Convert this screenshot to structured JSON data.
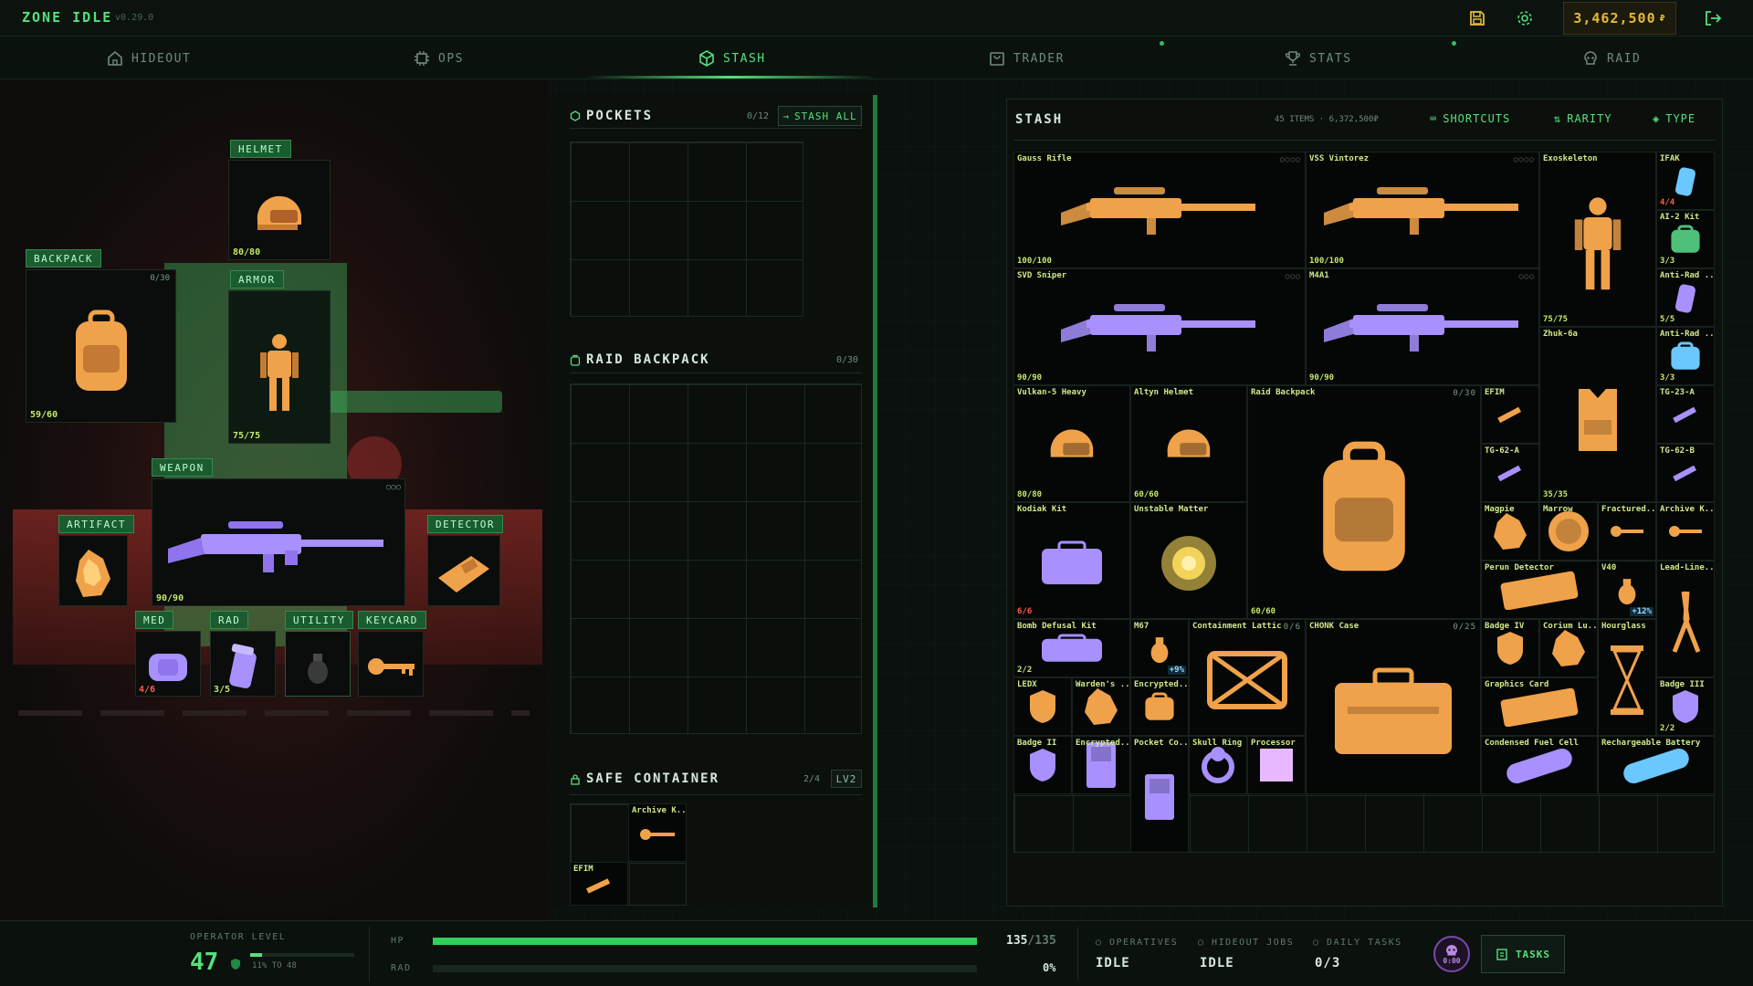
{
  "app": {
    "title": "ZONE IDLE",
    "version": "v0.29.0",
    "money": "3,462,500",
    "currency": "₽"
  },
  "nav": [
    {
      "label": "HIDEOUT",
      "icon": "house-icon"
    },
    {
      "label": "OPS",
      "icon": "chip-icon"
    },
    {
      "label": "STASH",
      "icon": "cube-icon",
      "active": true
    },
    {
      "label": "TRADER",
      "icon": "cart-icon"
    },
    {
      "label": "STATS",
      "icon": "trophy-icon"
    },
    {
      "label": "RAID",
      "icon": "skull-icon"
    }
  ],
  "loadout": {
    "helmet": {
      "label": "HELMET",
      "qty": "80/80"
    },
    "backpack": {
      "label": "BACKPACK",
      "qty": "59/60",
      "cap": "0/30"
    },
    "armor": {
      "label": "ARMOR",
      "qty": "75/75"
    },
    "weapon": {
      "label": "WEAPON",
      "qty": "90/90",
      "mods": "○○○"
    },
    "artifact": {
      "label": "ARTIFACT"
    },
    "detector": {
      "label": "DETECTOR"
    },
    "med": {
      "label": "MED",
      "qty": "4/6"
    },
    "rad": {
      "label": "RAD",
      "qty": "3/5"
    },
    "utility": {
      "label": "UTILITY"
    },
    "keycard": {
      "label": "KEYCARD"
    }
  },
  "pockets": {
    "title": "POCKETS",
    "count": "0/12",
    "stash_all": "STASH ALL"
  },
  "raid_backpack": {
    "title": "RAID BACKPACK",
    "count": "0/30"
  },
  "safe": {
    "title": "SAFE CONTAINER",
    "count": "2/4",
    "level": "LV2",
    "items": [
      {
        "name": "Archive K..."
      },
      {
        "name": "EFIM"
      }
    ]
  },
  "stash": {
    "title": "STASH",
    "summary": "45 ITEMS · 6,372,500₽",
    "shortcuts": "SHORTCUTS",
    "rarity": "RARITY",
    "type": "TYPE",
    "items": [
      {
        "name": "Gauss Rifle",
        "qty": "100/100",
        "dots": "○○○○"
      },
      {
        "name": "VSS Vintorez",
        "qty": "100/100",
        "dots": "○○○○"
      },
      {
        "name": "Exoskeleton",
        "qty": "75/75"
      },
      {
        "name": "IFAK",
        "qty": "4/4"
      },
      {
        "name": "AI-2 Kit",
        "qty": "3/3"
      },
      {
        "name": "Anti-Rad ...",
        "qty": "5/5"
      },
      {
        "name": "Anti-Rad ...",
        "qty": "3/3"
      },
      {
        "name": "SVD Sniper",
        "qty": "90/90",
        "dots": "○○○"
      },
      {
        "name": "M4A1",
        "qty": "90/90",
        "dots": "○○○"
      },
      {
        "name": "Zhuk-6a",
        "qty": "35/35"
      },
      {
        "name": "TG-23-A"
      },
      {
        "name": "TG-62-B"
      },
      {
        "name": "Vulkan-5 Heavy",
        "qty": "80/80"
      },
      {
        "name": "Altyn Helmet",
        "qty": "60/60"
      },
      {
        "name": "Raid Backpack",
        "qty": "60/60",
        "cap": "0/30"
      },
      {
        "name": "EFIM"
      },
      {
        "name": "TG-62-A"
      },
      {
        "name": "Kodiak Kit",
        "qty": "6/6"
      },
      {
        "name": "Unstable Matter"
      },
      {
        "name": "Magpie"
      },
      {
        "name": "Marrow"
      },
      {
        "name": "Fractured..."
      },
      {
        "name": "Archive K..."
      },
      {
        "name": "Perun Detector"
      },
      {
        "name": "V40",
        "badge": "+12%"
      },
      {
        "name": "Lead-Line..."
      },
      {
        "name": "Bomb Defusal Kit",
        "qty": "2/2"
      },
      {
        "name": "M67",
        "badge": "+9%"
      },
      {
        "name": "Containment Lattic",
        "cap": "0/6"
      },
      {
        "name": "CHONK Case",
        "cap": "0/25"
      },
      {
        "name": "Badge IV"
      },
      {
        "name": "Corium Lu..."
      },
      {
        "name": "Hourglass"
      },
      {
        "name": "LEDX"
      },
      {
        "name": "Warden's ..."
      },
      {
        "name": "Encrypted..."
      },
      {
        "name": "Graphics Card"
      },
      {
        "name": "Badge III",
        "qty": "2/2"
      },
      {
        "name": "Badge II"
      },
      {
        "name": "Encrypted..."
      },
      {
        "name": "Pocket Co..."
      },
      {
        "name": "Skull Ring"
      },
      {
        "name": "Processor"
      },
      {
        "name": "Condensed Fuel Cell"
      },
      {
        "name": "Rechargeable Battery"
      }
    ]
  },
  "bottom": {
    "op_label": "OPERATOR LEVEL",
    "level": "47",
    "xp": "11% TO 48",
    "xp_fraction": 0.11,
    "hp_label": "HP",
    "hp": "135",
    "hp_max": "/135",
    "hp_fraction": 1.0,
    "rad_label": "RAD",
    "rad": "0%",
    "rad_fraction": 0.0,
    "operatives_label": "OPERATIVES",
    "operatives": "IDLE",
    "jobs_label": "HIDEOUT JOBS",
    "jobs": "IDLE",
    "daily_label": "DAILY TASKS",
    "daily": "0/3",
    "timer": "0:00",
    "tasks": "TASKS"
  },
  "colors": {
    "accent": "#55e07a",
    "gold": "#e4b93a",
    "item_orange": "#f0a24a",
    "item_purple": "#a890ff",
    "rare_blue": "#6ac8ff"
  }
}
